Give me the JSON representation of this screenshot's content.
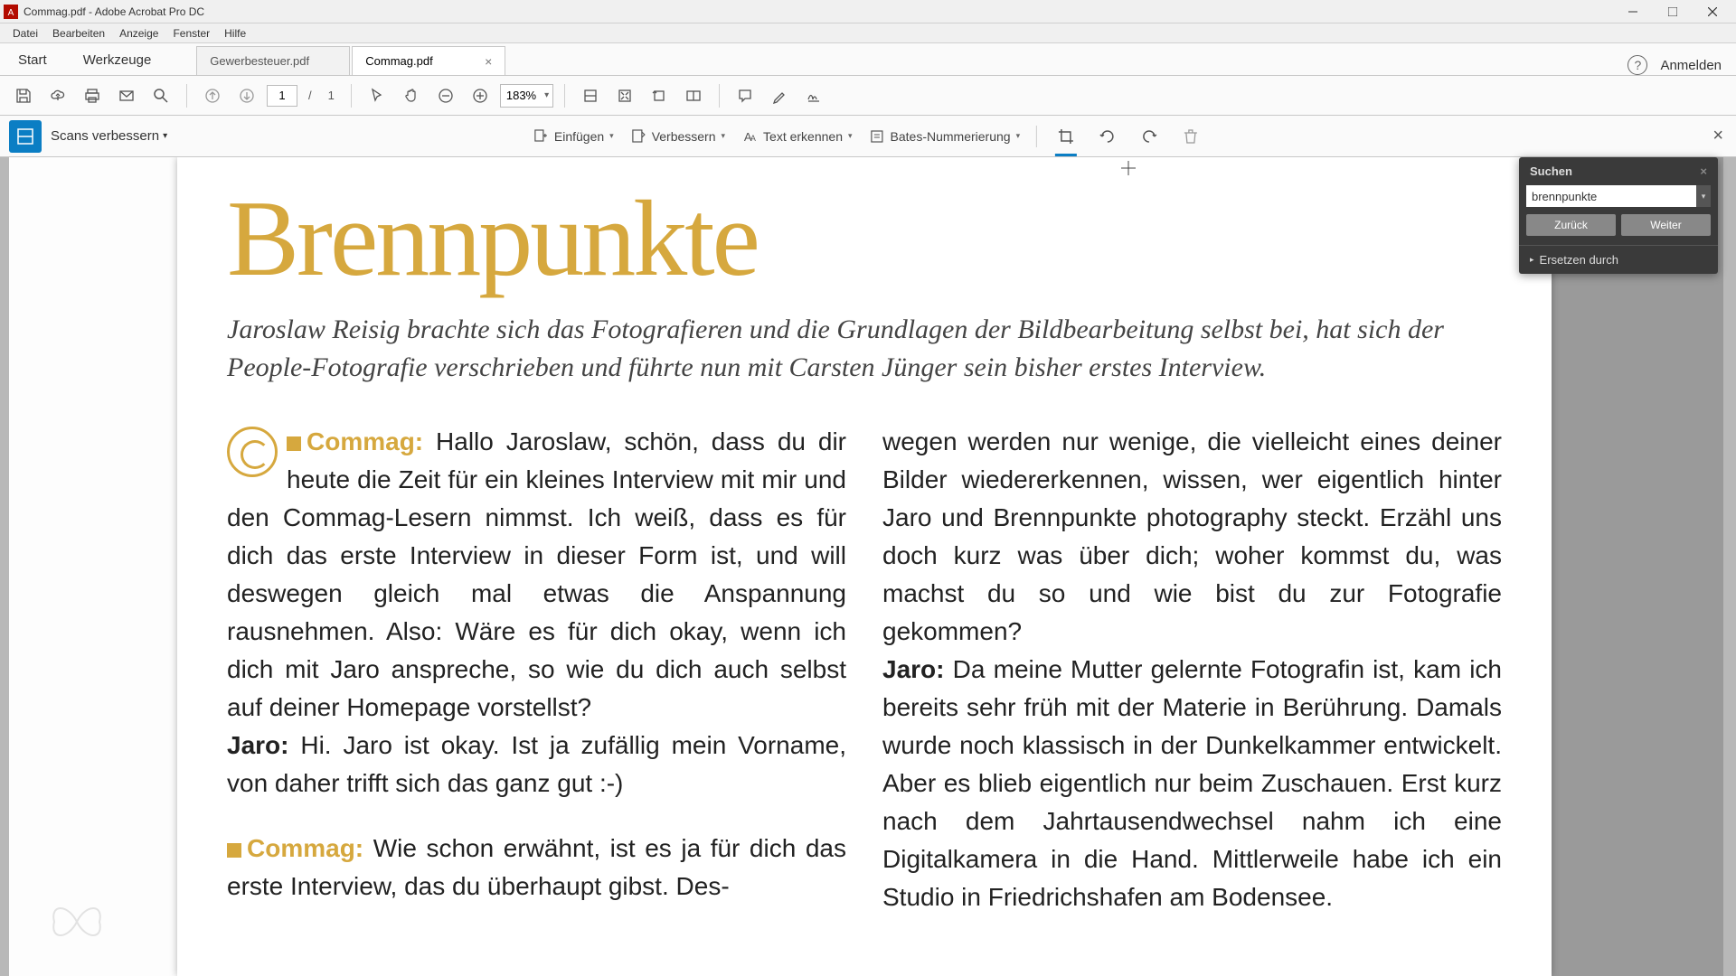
{
  "window": {
    "title": "Commag.pdf - Adobe Acrobat Pro DC"
  },
  "menu": {
    "items": [
      "Datei",
      "Bearbeiten",
      "Anzeige",
      "Fenster",
      "Hilfe"
    ]
  },
  "tabs": {
    "mode_start": "Start",
    "mode_tools": "Werkzeuge",
    "docs": [
      {
        "label": "Gewerbesteuer.pdf",
        "active": false
      },
      {
        "label": "Commag.pdf",
        "active": true
      }
    ],
    "signin": "Anmelden"
  },
  "toolbar": {
    "page_current": "1",
    "page_sep": "/",
    "page_total": "1",
    "zoom": "183%"
  },
  "toolbar2": {
    "scans_label": "Scans verbessern",
    "insert": "Einfügen",
    "enhance": "Verbessern",
    "recognize": "Text erkennen",
    "bates": "Bates-Nummerierung"
  },
  "search": {
    "title": "Suchen",
    "value": "brennpunkte",
    "back": "Zurück",
    "next": "Weiter",
    "replace": "Ersetzen durch"
  },
  "doc": {
    "headline": "Brennpunkte",
    "intro": "Jaroslaw Reisig brachte sich das Fotografieren und die Grundlagen der Bildbearbeitung selbst bei, hat sich der People-Fotografie verschrieben und führte nun mit Carsten Jünger sein bisher erstes Interview.",
    "commag_label": "Commag:",
    "jaro_label": "Jaro:",
    "p1": "Hallo Jaroslaw, schön, dass du dir heute die Zeit für ein kleines Interview mit mir und den Commag-Lesern nimmst. Ich weiß, dass es für dich das erste Interview in dieser Form ist, und will deswegen gleich mal etwas die Anspannung rausnehmen. Also: Wäre es für dich okay, wenn ich dich mit Jaro anspreche, so wie du dich auch selbst auf deiner Homepage vorstellst?",
    "p2": "Hi. Jaro ist okay. Ist ja zufällig mein Vorname, von daher trifft sich das ganz gut :-)",
    "p3": "Wie schon erwähnt, ist es ja für dich das erste Interview, das du überhaupt gibst. Des-",
    "p4": "wegen werden nur wenige, die vielleicht eines deiner Bilder wiedererkennen, wissen, wer eigentlich hinter Jaro und Brennpunkte photography steckt. Erzähl uns doch kurz was über dich; woher kommst du, was machst du so und wie bist du zur Fotografie gekommen?",
    "p5": "Da meine Mutter gelernte Fotografin ist, kam ich bereits sehr früh mit der Materie in Berührung. Damals wurde noch klassisch in der Dunkelkammer entwickelt. Aber es blieb eigentlich nur beim Zuschauen. Erst kurz nach dem Jahrtausendwechsel nahm ich eine Digitalkamera in die Hand. Mittlerweile habe ich ein Studio in Friedrichshafen am Bodensee."
  }
}
